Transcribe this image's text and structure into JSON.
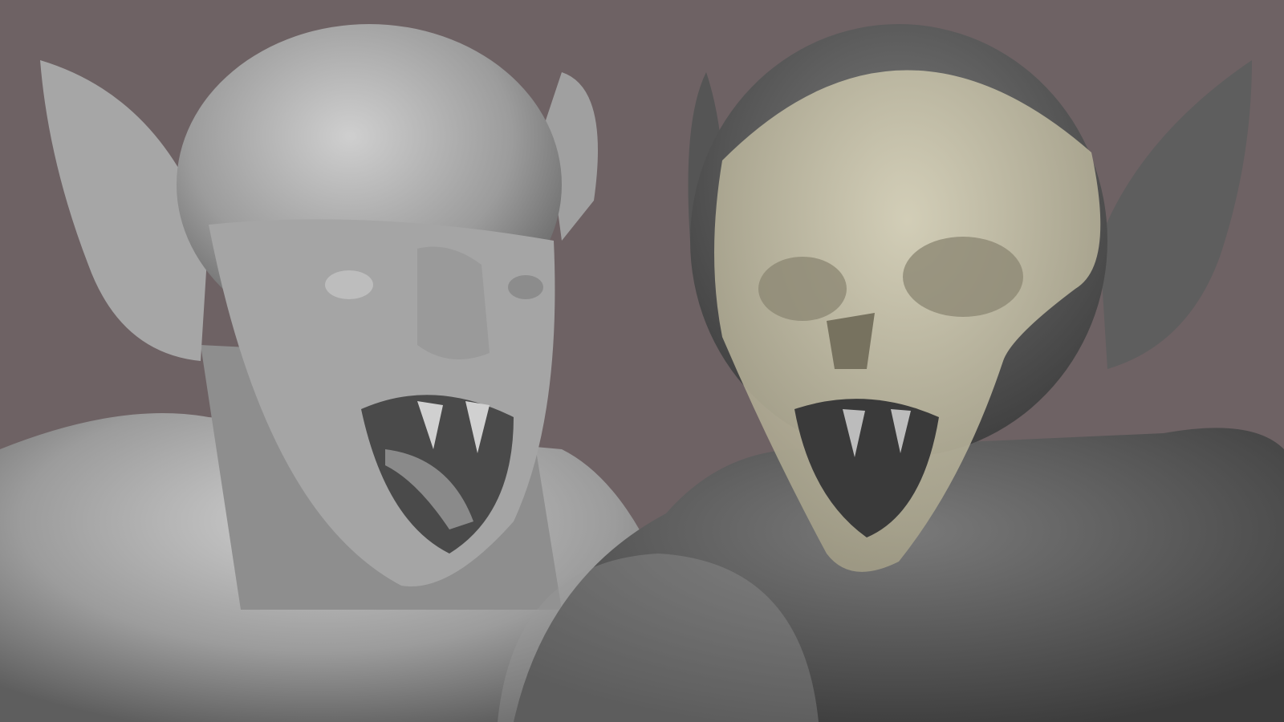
{
  "colors": {
    "background": "#6e6264",
    "left_sculpt": "#9a9a9a",
    "left_sculpt_light": "#c4c4c4",
    "right_sculpt": "#5a5a5a",
    "skull_overlay": "#c9c3a8"
  }
}
